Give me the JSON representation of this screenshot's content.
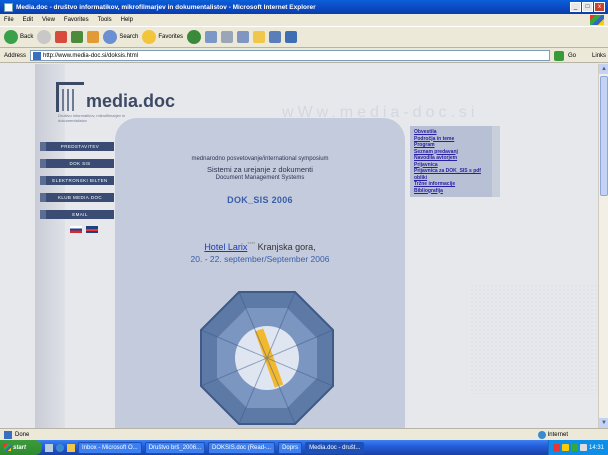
{
  "window": {
    "title": "Media.doc - društvo informatikov, mikrofilmarjev in dokumentalistov - Microsoft Internet Explorer",
    "min_label": "_",
    "max_label": "□",
    "close_label": "x"
  },
  "menubar": {
    "items": [
      "File",
      "Edit",
      "View",
      "Favorites",
      "Tools",
      "Help"
    ]
  },
  "toolbar": {
    "back_label": "Back",
    "search_label": "Search",
    "favorites_label": "Favorites"
  },
  "address": {
    "label": "Address",
    "url": "http://www.media-doc.si/doksis.html",
    "go_label": "Go",
    "links_label": "Links"
  },
  "site": {
    "logo_text": "media.doc",
    "logo_sub": "Društvo informatikov, mikrofilmarjev in dokumentalistov",
    "watermark": "wWw.media-doc.si",
    "nav": [
      "PREDSTAVITEV",
      "DOK SIS",
      "ELEKTRONSKI BILTEN",
      "KLUB MEDIA.DOC",
      "EMAIL"
    ],
    "symposium": "mednarodno posvetovanje/international symposium",
    "sistemi": "Sistemi za urejanje z dokumenti",
    "dms": "Document Management Systems",
    "doksis": "DOK_SIS 2006",
    "hotel_link": "Hotel Larix",
    "hotel_stars": "****",
    "hotel_place": " Kranjska gora,",
    "dates": "20. - 22. september/September 2006",
    "right_menu": [
      "Obvestila",
      "Področja in teme",
      "Program",
      "Seznam predavanj",
      "Navodila avtorjem",
      "Prijavnica",
      "Prijavnica za DOK_SIS s pdf obliki",
      "Tržne informacije",
      "Bibliografija"
    ]
  },
  "status": {
    "text": "Done",
    "zone": "Internet"
  },
  "taskbar": {
    "start_label": "start",
    "items": [
      "Inbox - Microsoft O...",
      "Društvo brš_2006...",
      "DOKSIS.doc (Read-...",
      "Doprs",
      "Media.doc - društ..."
    ],
    "clock": "14:31"
  }
}
